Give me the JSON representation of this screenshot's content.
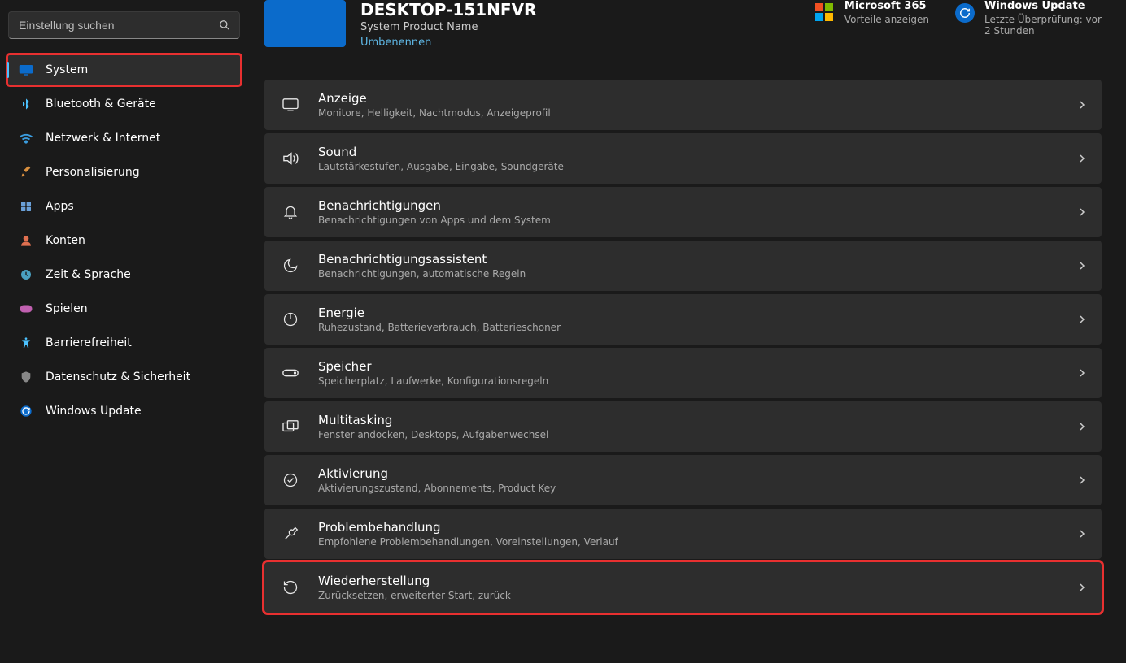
{
  "search": {
    "placeholder": "Einstellung suchen"
  },
  "sidebar": {
    "items": [
      {
        "label": "System",
        "icon": "display-icon",
        "color": "#0b6bcb",
        "active": true,
        "highlighted": true
      },
      {
        "label": "Bluetooth & Geräte",
        "icon": "bluetooth-icon",
        "color": "#4cc2ff"
      },
      {
        "label": "Netzwerk & Internet",
        "icon": "wifi-icon",
        "color": "#3b9de0"
      },
      {
        "label": "Personalisierung",
        "icon": "paintbrush-icon",
        "color": "#d98f3e"
      },
      {
        "label": "Apps",
        "icon": "apps-icon",
        "color": "#6aa0d8"
      },
      {
        "label": "Konten",
        "icon": "person-icon",
        "color": "#e07050"
      },
      {
        "label": "Zeit & Sprache",
        "icon": "clock-icon",
        "color": "#4aa0c0"
      },
      {
        "label": "Spielen",
        "icon": "gamepad-icon",
        "color": "#c060b0"
      },
      {
        "label": "Barrierefreiheit",
        "icon": "accessibility-icon",
        "color": "#4cc2ff"
      },
      {
        "label": "Datenschutz & Sicherheit",
        "icon": "shield-icon",
        "color": "#888"
      },
      {
        "label": "Windows Update",
        "icon": "update-icon",
        "color": "#0b6bcb"
      }
    ]
  },
  "header": {
    "pc_name": "DESKTOP-151NFVR",
    "product": "System Product Name",
    "rename": "Umbenennen",
    "ms365": {
      "title": "Microsoft 365",
      "sub": "Vorteile anzeigen"
    },
    "wu": {
      "title": "Windows Update",
      "sub": "Letzte Überprüfung: vor 2 Stunden"
    }
  },
  "rows": [
    {
      "icon": "monitor-icon",
      "title": "Anzeige",
      "sub": "Monitore, Helligkeit, Nachtmodus, Anzeigeprofil"
    },
    {
      "icon": "sound-icon",
      "title": "Sound",
      "sub": "Lautstärkestufen, Ausgabe, Eingabe, Soundgeräte"
    },
    {
      "icon": "bell-icon",
      "title": "Benachrichtigungen",
      "sub": "Benachrichtigungen von Apps und dem System"
    },
    {
      "icon": "moon-icon",
      "title": "Benachrichtigungsassistent",
      "sub": "Benachrichtigungen, automatische Regeln"
    },
    {
      "icon": "power-icon",
      "title": "Energie",
      "sub": "Ruhezustand, Batterieverbrauch, Batterieschoner"
    },
    {
      "icon": "storage-icon",
      "title": "Speicher",
      "sub": "Speicherplatz, Laufwerke, Konfigurationsregeln"
    },
    {
      "icon": "multitask-icon",
      "title": "Multitasking",
      "sub": "Fenster andocken, Desktops, Aufgabenwechsel"
    },
    {
      "icon": "check-icon",
      "title": "Aktivierung",
      "sub": "Aktivierungszustand, Abonnements, Product Key"
    },
    {
      "icon": "wrench-icon",
      "title": "Problembehandlung",
      "sub": "Empfohlene Problembehandlungen, Voreinstellungen, Verlauf"
    },
    {
      "icon": "recovery-icon",
      "title": "Wiederherstellung",
      "sub": "Zurücksetzen, erweiterter Start, zurück",
      "highlighted": true
    }
  ]
}
